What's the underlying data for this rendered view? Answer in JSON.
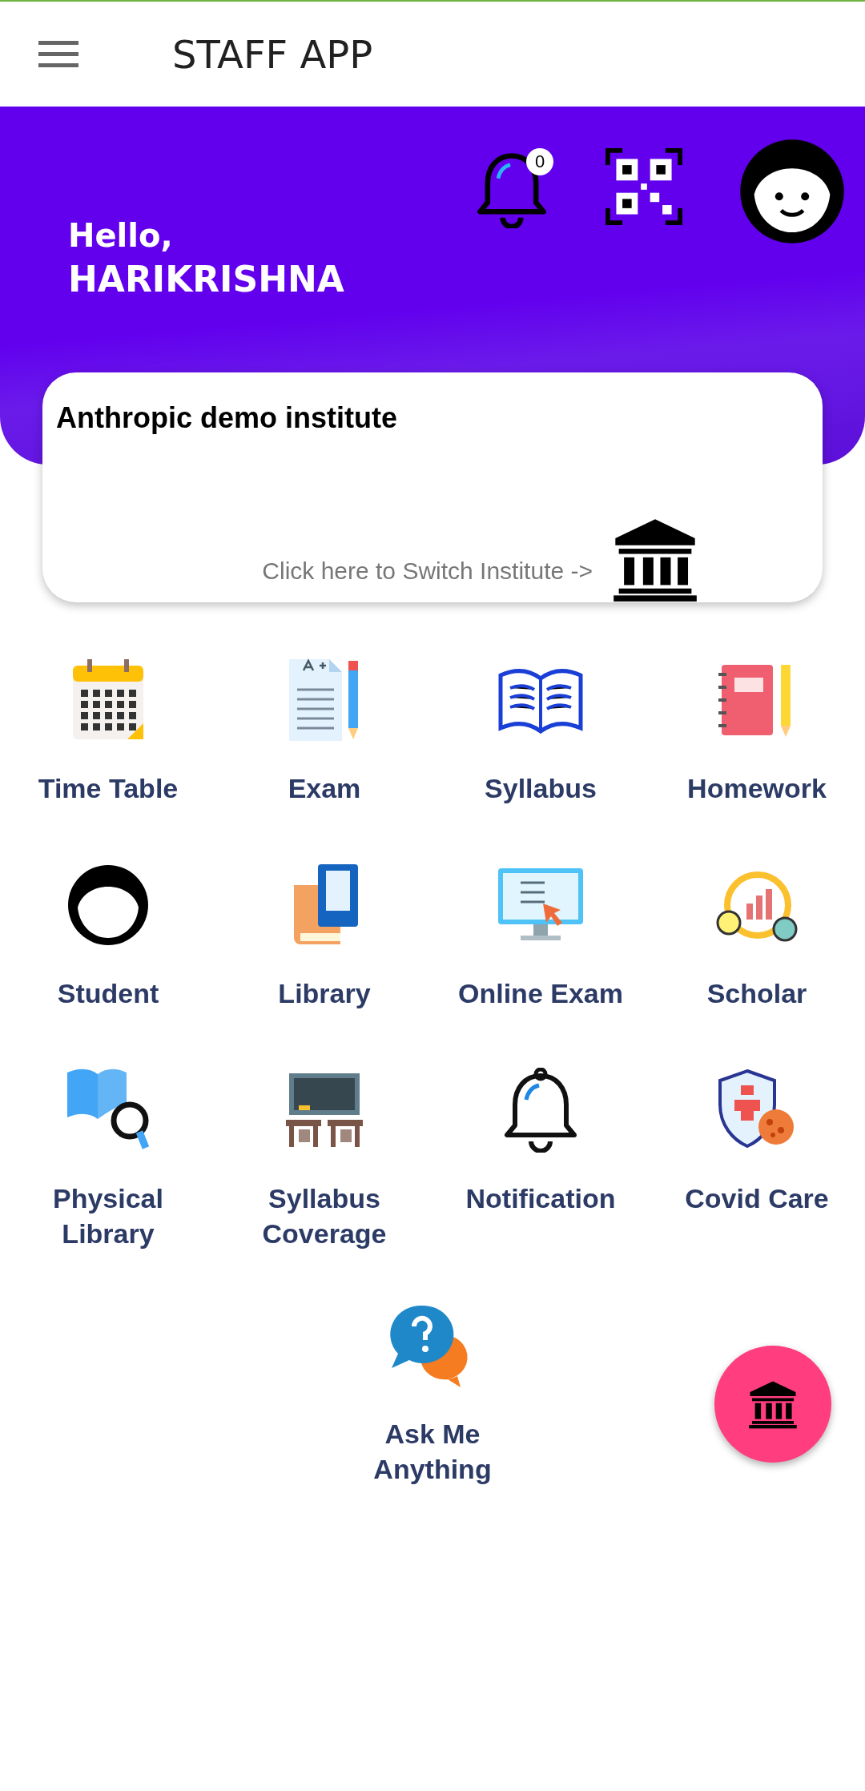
{
  "app_bar": {
    "title": "STAFF APP"
  },
  "header": {
    "greeting": "Hello,",
    "name": "HARIKRISHNA",
    "notification_count": "0"
  },
  "institute_card": {
    "name": "Anthropic demo institute",
    "switch_link": "Click here to Switch Institute ->"
  },
  "menu": [
    {
      "label": "Time Table"
    },
    {
      "label": "Exam"
    },
    {
      "label": "Syllabus"
    },
    {
      "label": "Homework"
    },
    {
      "label": "Student"
    },
    {
      "label": "Library"
    },
    {
      "label": "Online Exam"
    },
    {
      "label": "Scholar"
    },
    {
      "label": "Physical Library"
    },
    {
      "label": "Syllabus Coverage"
    },
    {
      "label": "Notification"
    },
    {
      "label": "Covid Care"
    },
    {
      "label": "Ask Me Anything"
    }
  ]
}
